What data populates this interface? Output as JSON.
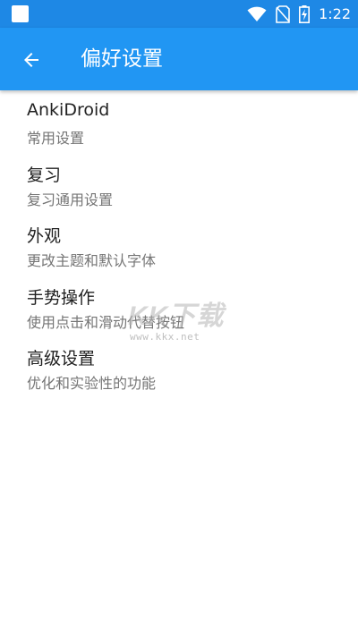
{
  "status_bar": {
    "time": "1:22",
    "icons": [
      "app-notification-icon",
      "wifi-icon",
      "no-sim-icon",
      "battery-charging-icon"
    ],
    "background": "#1e88e5"
  },
  "app_bar": {
    "title": "偏好设置",
    "back_icon": "arrow-left-icon",
    "background": "#2196f3"
  },
  "preferences": [
    {
      "title": "AnkiDroid",
      "summary": "常用设置"
    },
    {
      "title": "复习",
      "summary": "复习通用设置"
    },
    {
      "title": "外观",
      "summary": "更改主题和默认字体"
    },
    {
      "title": "手势操作",
      "summary": "使用点击和滑动代替按钮"
    },
    {
      "title": "高级设置",
      "summary": "优化和实验性的功能"
    }
  ],
  "watermark": {
    "logo_text": "KK下载",
    "url": "www.kkx.net"
  }
}
